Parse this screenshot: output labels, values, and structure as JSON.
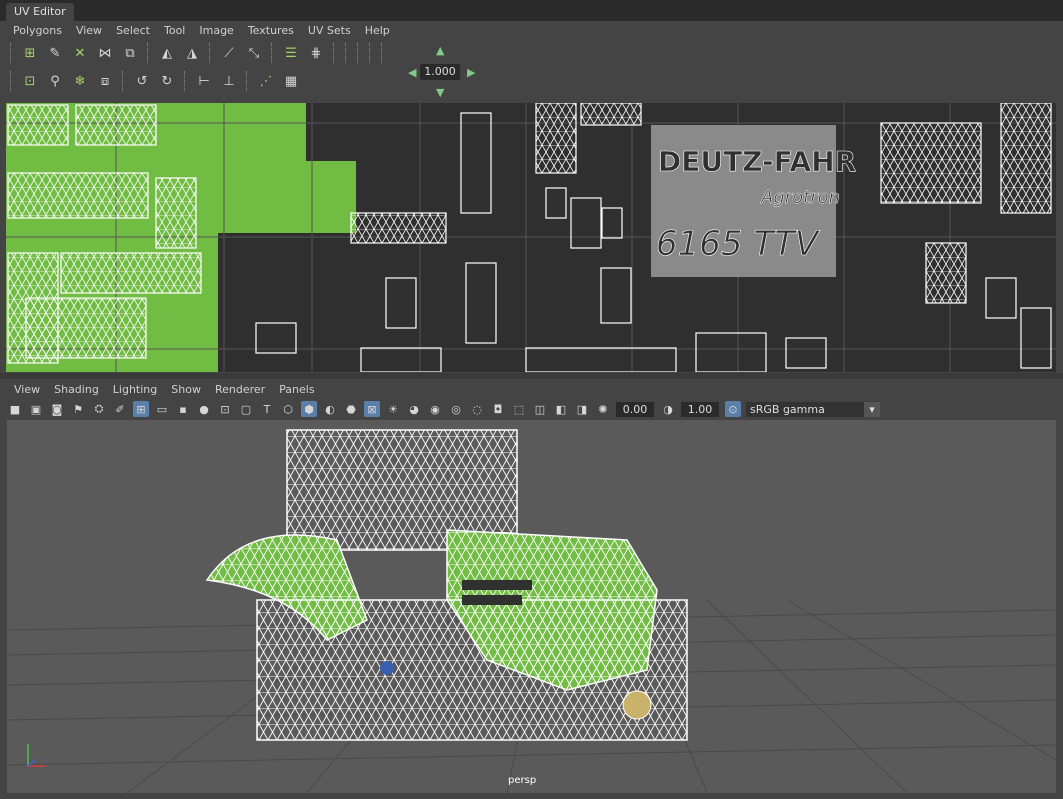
{
  "window": {
    "title": "UV Editor"
  },
  "uv_editor": {
    "menu": [
      "Polygons",
      "View",
      "Select",
      "Tool",
      "Image",
      "Textures",
      "UV Sets",
      "Help"
    ],
    "zoom_value": "1.000",
    "texture_text": {
      "brand": "DEUTZ-FAHR",
      "model": "Agrotron",
      "number": "6165 TTV"
    }
  },
  "viewport": {
    "menu": [
      "View",
      "Shading",
      "Lighting",
      "Show",
      "Renderer",
      "Panels"
    ],
    "exposure_value": "0.00",
    "gamma_value": "1.00",
    "color_space": "sRGB gamma",
    "camera_label": "persp"
  },
  "colors": {
    "uv_fill": "#71bc43",
    "viewport_bg": "#5a5a5a",
    "uv_bg": "#2f2f2f",
    "wire": "#ffffff"
  }
}
